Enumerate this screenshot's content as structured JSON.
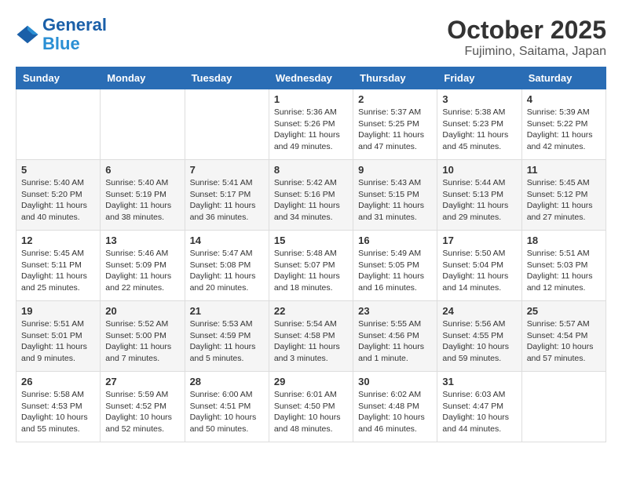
{
  "header": {
    "logo_line1": "General",
    "logo_line2": "Blue",
    "month": "October 2025",
    "location": "Fujimino, Saitama, Japan"
  },
  "weekdays": [
    "Sunday",
    "Monday",
    "Tuesday",
    "Wednesday",
    "Thursday",
    "Friday",
    "Saturday"
  ],
  "weeks": [
    [
      {
        "day": "",
        "info": ""
      },
      {
        "day": "",
        "info": ""
      },
      {
        "day": "",
        "info": ""
      },
      {
        "day": "1",
        "info": "Sunrise: 5:36 AM\nSunset: 5:26 PM\nDaylight: 11 hours\nand 49 minutes."
      },
      {
        "day": "2",
        "info": "Sunrise: 5:37 AM\nSunset: 5:25 PM\nDaylight: 11 hours\nand 47 minutes."
      },
      {
        "day": "3",
        "info": "Sunrise: 5:38 AM\nSunset: 5:23 PM\nDaylight: 11 hours\nand 45 minutes."
      },
      {
        "day": "4",
        "info": "Sunrise: 5:39 AM\nSunset: 5:22 PM\nDaylight: 11 hours\nand 42 minutes."
      }
    ],
    [
      {
        "day": "5",
        "info": "Sunrise: 5:40 AM\nSunset: 5:20 PM\nDaylight: 11 hours\nand 40 minutes."
      },
      {
        "day": "6",
        "info": "Sunrise: 5:40 AM\nSunset: 5:19 PM\nDaylight: 11 hours\nand 38 minutes."
      },
      {
        "day": "7",
        "info": "Sunrise: 5:41 AM\nSunset: 5:17 PM\nDaylight: 11 hours\nand 36 minutes."
      },
      {
        "day": "8",
        "info": "Sunrise: 5:42 AM\nSunset: 5:16 PM\nDaylight: 11 hours\nand 34 minutes."
      },
      {
        "day": "9",
        "info": "Sunrise: 5:43 AM\nSunset: 5:15 PM\nDaylight: 11 hours\nand 31 minutes."
      },
      {
        "day": "10",
        "info": "Sunrise: 5:44 AM\nSunset: 5:13 PM\nDaylight: 11 hours\nand 29 minutes."
      },
      {
        "day": "11",
        "info": "Sunrise: 5:45 AM\nSunset: 5:12 PM\nDaylight: 11 hours\nand 27 minutes."
      }
    ],
    [
      {
        "day": "12",
        "info": "Sunrise: 5:45 AM\nSunset: 5:11 PM\nDaylight: 11 hours\nand 25 minutes."
      },
      {
        "day": "13",
        "info": "Sunrise: 5:46 AM\nSunset: 5:09 PM\nDaylight: 11 hours\nand 22 minutes."
      },
      {
        "day": "14",
        "info": "Sunrise: 5:47 AM\nSunset: 5:08 PM\nDaylight: 11 hours\nand 20 minutes."
      },
      {
        "day": "15",
        "info": "Sunrise: 5:48 AM\nSunset: 5:07 PM\nDaylight: 11 hours\nand 18 minutes."
      },
      {
        "day": "16",
        "info": "Sunrise: 5:49 AM\nSunset: 5:05 PM\nDaylight: 11 hours\nand 16 minutes."
      },
      {
        "day": "17",
        "info": "Sunrise: 5:50 AM\nSunset: 5:04 PM\nDaylight: 11 hours\nand 14 minutes."
      },
      {
        "day": "18",
        "info": "Sunrise: 5:51 AM\nSunset: 5:03 PM\nDaylight: 11 hours\nand 12 minutes."
      }
    ],
    [
      {
        "day": "19",
        "info": "Sunrise: 5:51 AM\nSunset: 5:01 PM\nDaylight: 11 hours\nand 9 minutes."
      },
      {
        "day": "20",
        "info": "Sunrise: 5:52 AM\nSunset: 5:00 PM\nDaylight: 11 hours\nand 7 minutes."
      },
      {
        "day": "21",
        "info": "Sunrise: 5:53 AM\nSunset: 4:59 PM\nDaylight: 11 hours\nand 5 minutes."
      },
      {
        "day": "22",
        "info": "Sunrise: 5:54 AM\nSunset: 4:58 PM\nDaylight: 11 hours\nand 3 minutes."
      },
      {
        "day": "23",
        "info": "Sunrise: 5:55 AM\nSunset: 4:56 PM\nDaylight: 11 hours\nand 1 minute."
      },
      {
        "day": "24",
        "info": "Sunrise: 5:56 AM\nSunset: 4:55 PM\nDaylight: 10 hours\nand 59 minutes."
      },
      {
        "day": "25",
        "info": "Sunrise: 5:57 AM\nSunset: 4:54 PM\nDaylight: 10 hours\nand 57 minutes."
      }
    ],
    [
      {
        "day": "26",
        "info": "Sunrise: 5:58 AM\nSunset: 4:53 PM\nDaylight: 10 hours\nand 55 minutes."
      },
      {
        "day": "27",
        "info": "Sunrise: 5:59 AM\nSunset: 4:52 PM\nDaylight: 10 hours\nand 52 minutes."
      },
      {
        "day": "28",
        "info": "Sunrise: 6:00 AM\nSunset: 4:51 PM\nDaylight: 10 hours\nand 50 minutes."
      },
      {
        "day": "29",
        "info": "Sunrise: 6:01 AM\nSunset: 4:50 PM\nDaylight: 10 hours\nand 48 minutes."
      },
      {
        "day": "30",
        "info": "Sunrise: 6:02 AM\nSunset: 4:48 PM\nDaylight: 10 hours\nand 46 minutes."
      },
      {
        "day": "31",
        "info": "Sunrise: 6:03 AM\nSunset: 4:47 PM\nDaylight: 10 hours\nand 44 minutes."
      },
      {
        "day": "",
        "info": ""
      }
    ]
  ]
}
